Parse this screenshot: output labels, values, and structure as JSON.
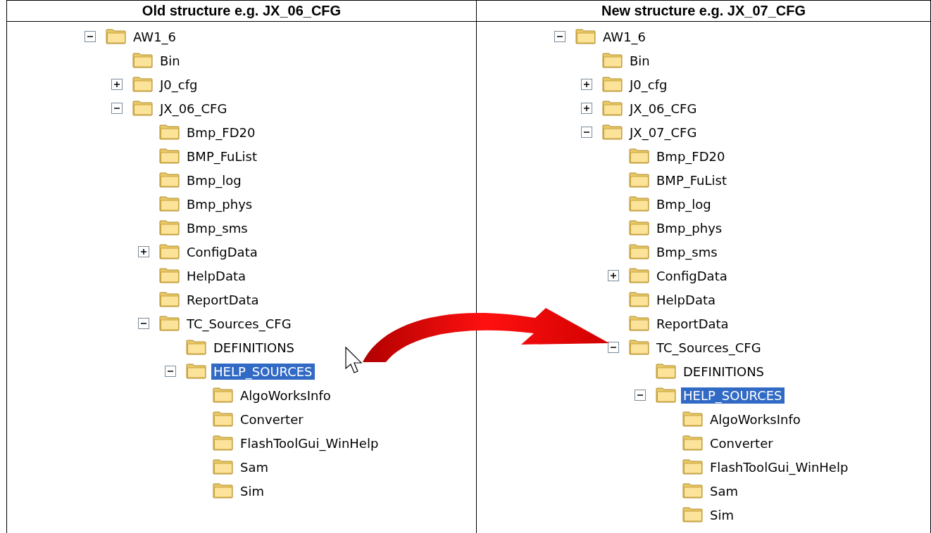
{
  "columns": [
    {
      "heading": "Old structure e.g. JX_06_CFG",
      "tree": [
        {
          "label": "AW1_6",
          "expanded": true,
          "selected": false,
          "children": [
            {
              "label": "Bin",
              "selected": false
            },
            {
              "label": "J0_cfg",
              "expanded": false,
              "selected": false
            },
            {
              "label": "JX_06_CFG",
              "expanded": true,
              "selected": false,
              "children": [
                {
                  "label": "Bmp_FD20",
                  "selected": false
                },
                {
                  "label": "BMP_FuList",
                  "selected": false
                },
                {
                  "label": "Bmp_log",
                  "selected": false
                },
                {
                  "label": "Bmp_phys",
                  "selected": false
                },
                {
                  "label": "Bmp_sms",
                  "selected": false
                },
                {
                  "label": "ConfigData",
                  "expanded": false,
                  "selected": false
                },
                {
                  "label": "HelpData",
                  "selected": false
                },
                {
                  "label": "ReportData",
                  "selected": false
                },
                {
                  "label": "TC_Sources_CFG",
                  "expanded": true,
                  "selected": false,
                  "children": [
                    {
                      "label": "DEFINITIONS",
                      "selected": false
                    },
                    {
                      "label": "HELP_SOURCES",
                      "expanded": true,
                      "selected": true,
                      "children": [
                        {
                          "label": "AlgoWorksInfo",
                          "selected": false
                        },
                        {
                          "label": "Converter",
                          "selected": false
                        },
                        {
                          "label": "FlashToolGui_WinHelp",
                          "selected": false
                        },
                        {
                          "label": "Sam",
                          "selected": false
                        },
                        {
                          "label": "Sim",
                          "selected": false
                        }
                      ]
                    }
                  ]
                }
              ]
            }
          ]
        }
      ]
    },
    {
      "heading": "New structure e.g. JX_07_CFG",
      "tree": [
        {
          "label": "AW1_6",
          "expanded": true,
          "selected": false,
          "children": [
            {
              "label": "Bin",
              "selected": false
            },
            {
              "label": "J0_cfg",
              "expanded": false,
              "selected": false
            },
            {
              "label": "JX_06_CFG",
              "expanded": false,
              "selected": false
            },
            {
              "label": "JX_07_CFG",
              "expanded": true,
              "selected": false,
              "children": [
                {
                  "label": "Bmp_FD20",
                  "selected": false
                },
                {
                  "label": "BMP_FuList",
                  "selected": false
                },
                {
                  "label": "Bmp_log",
                  "selected": false
                },
                {
                  "label": "Bmp_phys",
                  "selected": false
                },
                {
                  "label": "Bmp_sms",
                  "selected": false
                },
                {
                  "label": "ConfigData",
                  "expanded": false,
                  "selected": false
                },
                {
                  "label": "HelpData",
                  "selected": false
                },
                {
                  "label": "ReportData",
                  "selected": false
                },
                {
                  "label": "TC_Sources_CFG",
                  "expanded": true,
                  "selected": false,
                  "children": [
                    {
                      "label": "DEFINITIONS",
                      "selected": false
                    },
                    {
                      "label": "HELP_SOURCES",
                      "expanded": true,
                      "selected": true,
                      "children": [
                        {
                          "label": "AlgoWorksInfo",
                          "selected": false
                        },
                        {
                          "label": "Converter",
                          "selected": false
                        },
                        {
                          "label": "FlashToolGui_WinHelp",
                          "selected": false
                        },
                        {
                          "label": "Sam",
                          "selected": false
                        },
                        {
                          "label": "Sim",
                          "selected": false
                        }
                      ]
                    }
                  ]
                }
              ]
            }
          ]
        }
      ]
    }
  ]
}
